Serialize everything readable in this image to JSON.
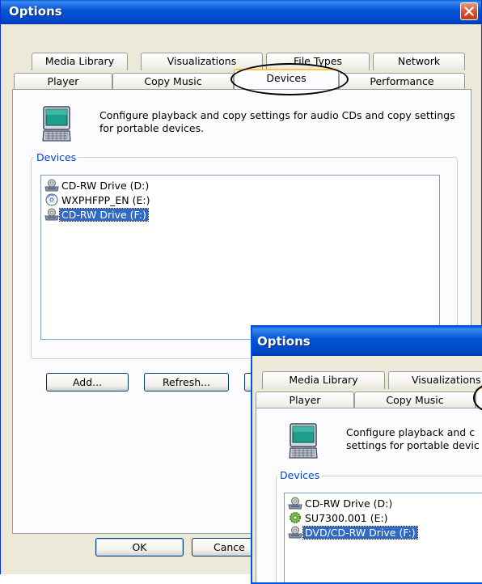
{
  "main_window": {
    "title": "Options",
    "tabs_row1": [
      "Media Library",
      "Visualizations",
      "File Types",
      "Network"
    ],
    "tabs_row2": [
      "Player",
      "Copy Music",
      "Devices",
      "Performance"
    ],
    "active_tab": "Devices",
    "description": "Configure playback and copy settings for audio CDs and copy settings for portable devices.",
    "group_label": "Devices",
    "devices": [
      {
        "label": "CD-RW Drive (D:)",
        "icon": "cd-drive-icon",
        "selected": false
      },
      {
        "label": "WXPHFPP_EN (E:)",
        "icon": "cd-disc-icon",
        "selected": false
      },
      {
        "label": "CD-RW Drive (F:)",
        "icon": "cd-drive-icon",
        "selected": true
      }
    ],
    "buttons": {
      "add": "Add...",
      "refresh": "Refresh..."
    },
    "footer": {
      "ok": "OK",
      "cancel": "Cance"
    }
  },
  "overlay_window": {
    "title": "Options",
    "tabs_row1": [
      "Media Library",
      "Visualizations"
    ],
    "tabs_row2": [
      "Player",
      "Copy Music"
    ],
    "description": "Configure playback and c settings for portable devic",
    "group_label": "Devices",
    "devices": [
      {
        "label": "CD-RW Drive (D:)",
        "icon": "cd-drive-icon",
        "selected": false
      },
      {
        "label": "SU7300.001 (E:)",
        "icon": "gear-icon",
        "selected": false
      },
      {
        "label": "DVD/CD-RW Drive (F:)",
        "icon": "dvd-drive-icon",
        "selected": true
      }
    ]
  },
  "colors": {
    "titlebar": "#0054e3",
    "dialog": "#ece9d8",
    "panel": "#fcfcfe",
    "selection": "#316ac5",
    "group_label": "#0046d5",
    "close_button": "#d5502a"
  }
}
